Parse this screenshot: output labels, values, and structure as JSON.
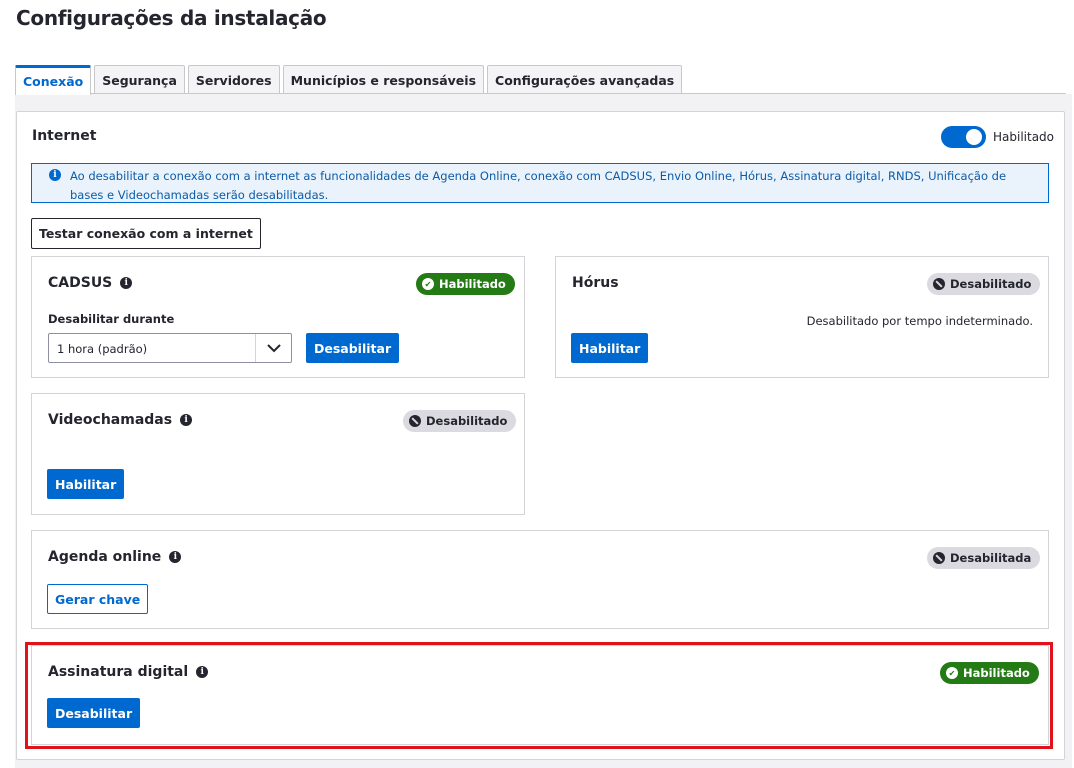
{
  "page": {
    "title": "Configurações da instalação"
  },
  "tabs": [
    {
      "label": "Conexão",
      "active": true
    },
    {
      "label": "Segurança",
      "active": false
    },
    {
      "label": "Servidores",
      "active": false
    },
    {
      "label": "Municípios e responsáveis",
      "active": false
    },
    {
      "label": "Configurações avançadas",
      "active": false
    }
  ],
  "internet": {
    "title": "Internet",
    "toggle_label": "Habilitado",
    "toggle_on": true,
    "alert_text": "Ao desabilitar a conexão com a internet as funcionalidades de Agenda Online, conexão com CADSUS, Envio Online, Hórus, Assinatura digital, RNDS, Unificação de bases e Videochamadas serão desabilitadas.",
    "test_button": "Testar conexão com a internet"
  },
  "cadsus": {
    "title": "CADSUS",
    "status": "Habilitado",
    "field_label": "Desabilitar durante",
    "select_value": "1 hora (padrão)",
    "button": "Desabilitar"
  },
  "horus": {
    "title": "Hórus",
    "status": "Desabilitado",
    "note": "Desabilitado por tempo indeterminado.",
    "button": "Habilitar"
  },
  "videochamadas": {
    "title": "Videochamadas",
    "status": "Desabilitado",
    "button": "Habilitar"
  },
  "agenda": {
    "title": "Agenda online",
    "status": "Desabilitada",
    "button": "Gerar chave"
  },
  "assinatura": {
    "title": "Assinatura digital",
    "status": "Habilitado",
    "button": "Desabilitar"
  },
  "colors": {
    "primary": "#0069d0",
    "success": "#247a14",
    "neutral_badge": "#dadae0",
    "highlight": "#e0121c"
  }
}
